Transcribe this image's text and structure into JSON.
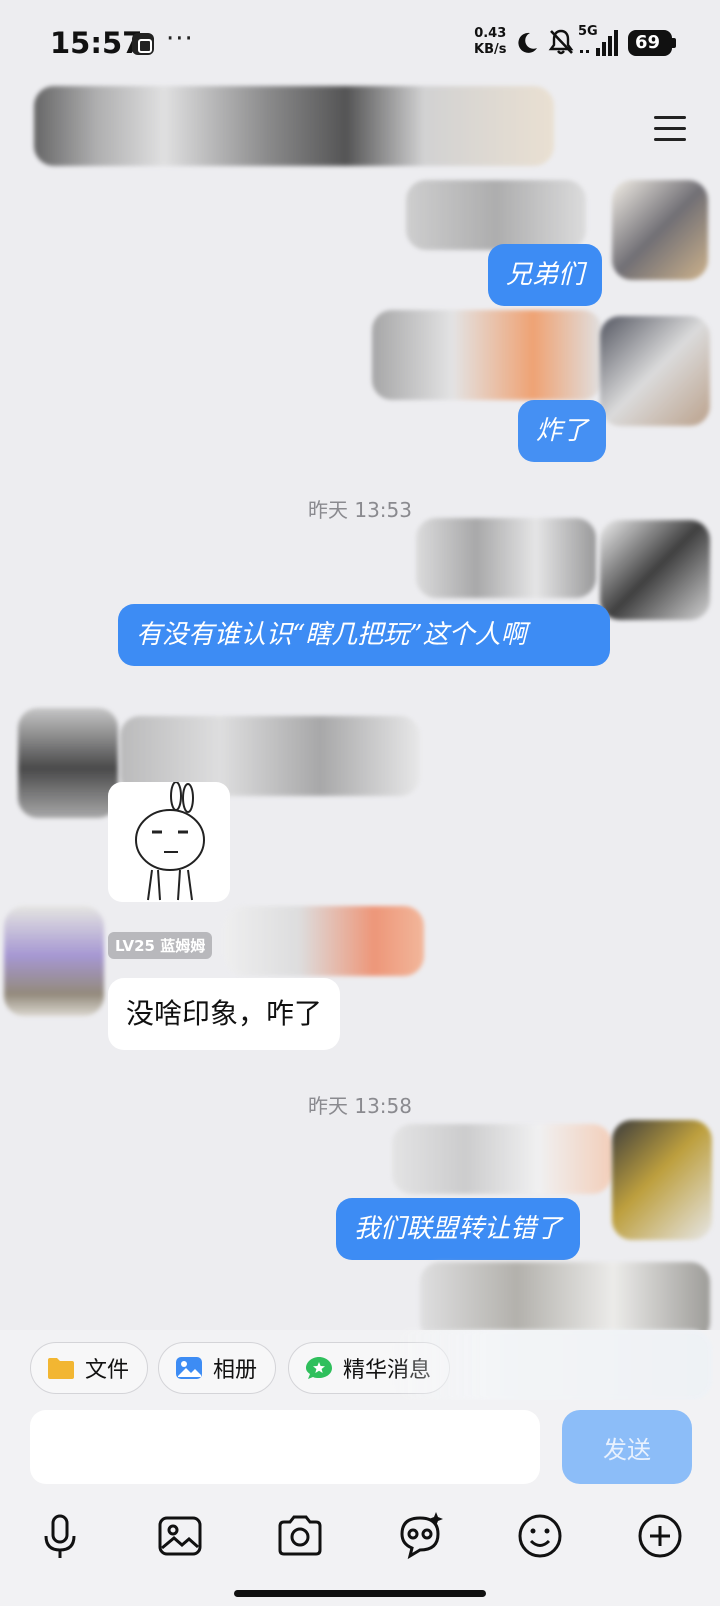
{
  "status_bar": {
    "time": "15:57",
    "net_speed_value": "0.43",
    "net_speed_unit": "KB/s",
    "network": "5G",
    "battery": "69",
    "icons": [
      "app-notification-icon",
      "more-dots-icon",
      "do-not-disturb-moon-icon",
      "bell-muted-icon",
      "signal-5g-icon",
      "battery-icon"
    ]
  },
  "header": {
    "menu_icon": "menu-icon"
  },
  "messages": [
    {
      "type": "outgoing",
      "text": "兄弟们"
    },
    {
      "type": "outgoing",
      "text": "炸了"
    },
    {
      "type": "timestamp",
      "text": "昨天 13:53"
    },
    {
      "type": "outgoing",
      "text": "有没有谁认识“瞎几把玩”这个人啊"
    },
    {
      "type": "incoming_sticker",
      "description": "rabbit-sticker"
    },
    {
      "type": "incoming",
      "badge": "LV25 蓝姆姆",
      "text": "没啥印象，咋了"
    },
    {
      "type": "timestamp",
      "text": "昨天 13:58"
    },
    {
      "type": "outgoing",
      "text": "我们联盟转让错了"
    }
  ],
  "quick_actions": [
    {
      "label": "文件",
      "icon": "folder-icon",
      "color": "#f2b632"
    },
    {
      "label": "相册",
      "icon": "photo-album-icon",
      "color": "#3d8cf4"
    },
    {
      "label": "精华消息",
      "icon": "star-message-icon",
      "color": "#2fbf5c"
    }
  ],
  "composer": {
    "input_value": "",
    "send_label": "发送"
  },
  "toolbar_icons": [
    "microphone-icon",
    "image-icon",
    "camera-icon",
    "ai-sticker-icon",
    "emoji-icon",
    "plus-icon"
  ],
  "colors": {
    "accent": "#3d8cf4",
    "background": "#ededf0",
    "send_disabled": "#8cbdf8"
  }
}
